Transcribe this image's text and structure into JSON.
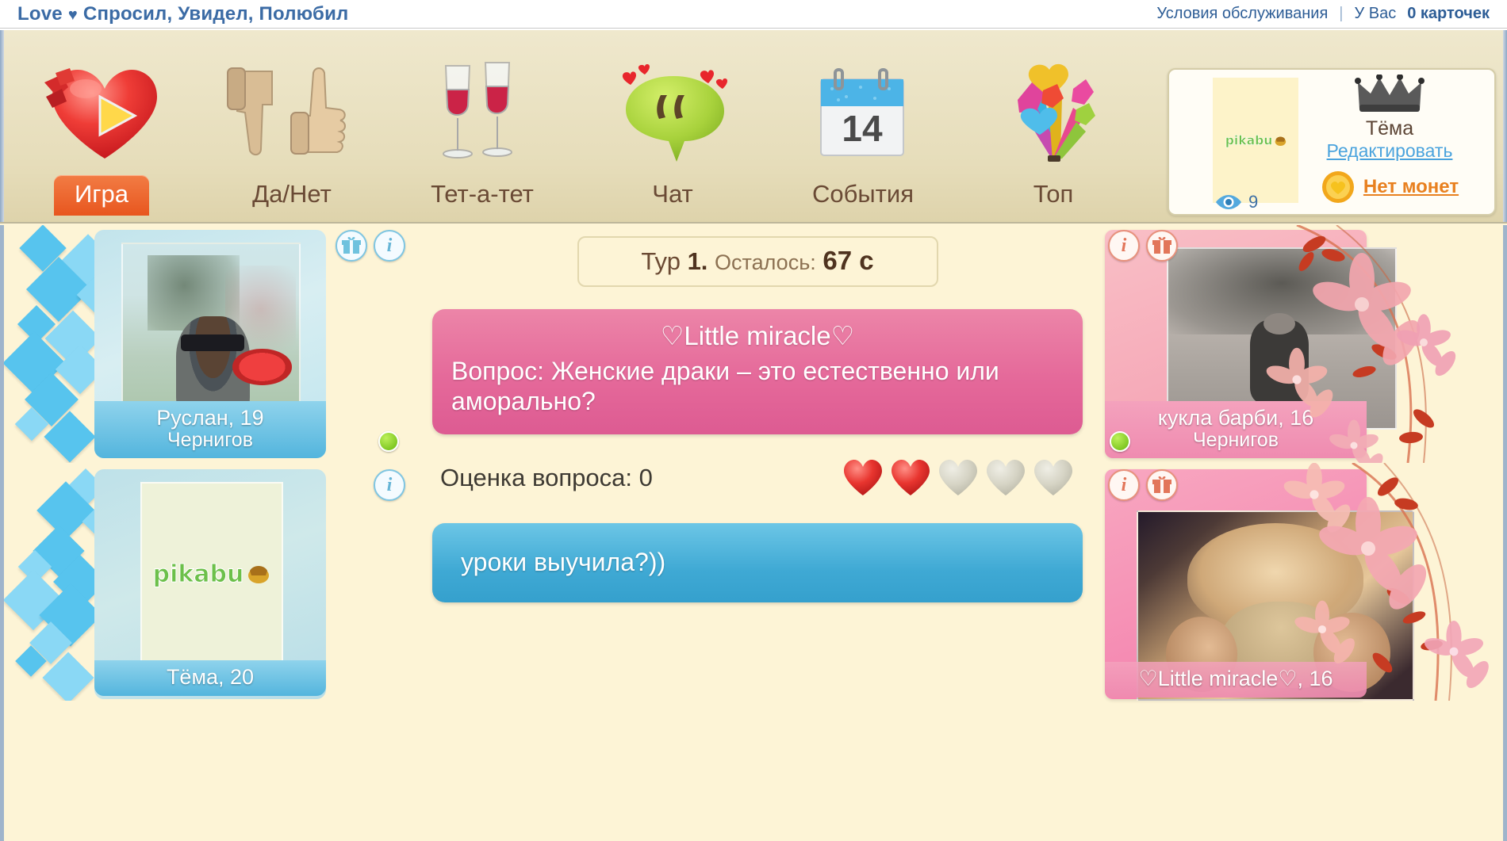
{
  "topbar": {
    "brand_name": "Love",
    "brand_heart": "♥",
    "brand_tagline": "Спросил, Увидел, Полюбил",
    "terms_link": "Условия обслуживания",
    "separator": "|",
    "cards_prefix": "У Вас",
    "cards_count": "0 карточек"
  },
  "nav": {
    "items": [
      {
        "label": "Игра",
        "icon": "heart-play-icon",
        "active": true
      },
      {
        "label": "Да/Нет",
        "icon": "thumbs-icon",
        "active": false
      },
      {
        "label": "Тет-а-тет",
        "icon": "wine-glasses-icon",
        "active": false
      },
      {
        "label": "Чат",
        "icon": "speech-bubble-icon",
        "active": false
      },
      {
        "label": "События",
        "icon": "calendar-14-icon",
        "active": false
      },
      {
        "label": "Топ",
        "icon": "bouquet-icon",
        "active": false
      }
    ]
  },
  "profile": {
    "avatar_logo": "pikabu",
    "views_count": "9",
    "name": "Тёма",
    "edit_link": "Редактировать",
    "coins_label": "Нет монет",
    "crown_icon": "crown-icon",
    "eye_icon": "eye-icon",
    "coin_icon": "coin-heart-icon"
  },
  "game": {
    "timer": {
      "round_label": "Тур",
      "round_number": "1.",
      "remaining_label": "Осталось:",
      "seconds": "67 с"
    },
    "question": {
      "author": "♡Little miracle♡",
      "text": "Вопрос: Женские драки – это естественно или аморально?"
    },
    "rating": {
      "label": "Оценка вопроса: 0",
      "value": 0,
      "filled": 2,
      "total": 5
    },
    "answer": {
      "text": "уроки выучила?))"
    }
  },
  "players": {
    "left": [
      {
        "name": "Руслан, 19",
        "city": "Чернигов",
        "online": true,
        "has_gift": true,
        "has_info": true,
        "photo": "man-sunglasses-park-photo"
      },
      {
        "name": "Тёма, 20",
        "city": "",
        "online": false,
        "has_gift": false,
        "has_info": true,
        "photo": "pikabu-logo-placeholder"
      }
    ],
    "right": [
      {
        "name": "кукла барби, 16",
        "city": "Чернигов",
        "online": true,
        "has_gift": true,
        "has_info": true,
        "photo": "person-crouching-road-photo"
      },
      {
        "name": "♡Little miracle♡, 16",
        "city": "",
        "online": true,
        "has_gift": true,
        "has_info": true,
        "photo": "woman-portrait-photo"
      }
    ]
  },
  "colors": {
    "page_bg": "#fdf4d6",
    "nav_bg": "#e9e0c2",
    "active_tab": "#e8561f",
    "question_bubble": "#e5699a",
    "answer_bubble": "#3fa9d4",
    "left_card": "#bfe2ea",
    "right_card": "#f6a9b8",
    "link_blue": "#2d5d96",
    "coin_orange": "#e8801f",
    "online_green": "#68b80d"
  }
}
